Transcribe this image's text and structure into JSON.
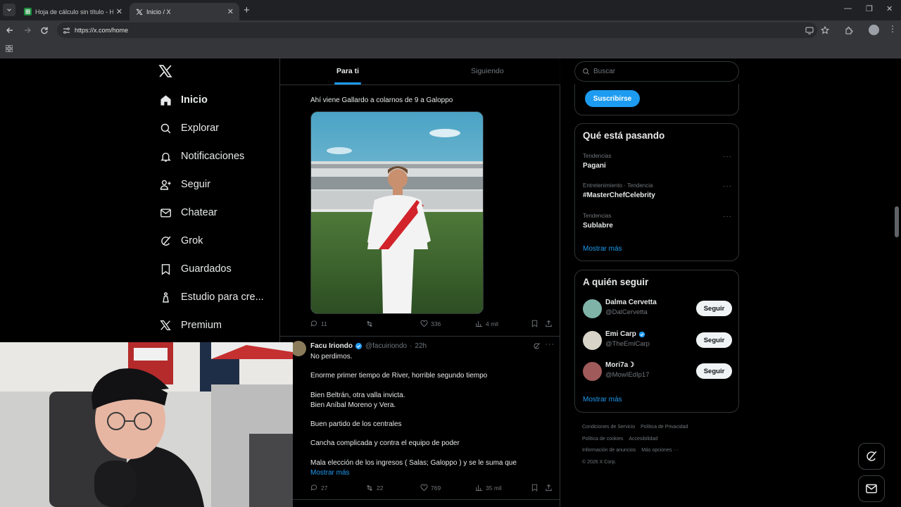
{
  "browser": {
    "tabs": [
      {
        "title": "Hoja de cálculo sin título - Hojas",
        "icon": "sheets-icon"
      },
      {
        "title": "Inicio / X",
        "icon": "x-logo-icon"
      }
    ],
    "url": "https://x.com/home"
  },
  "nav": {
    "items": [
      {
        "label": "Inicio",
        "icon": "home-icon"
      },
      {
        "label": "Explorar",
        "icon": "search-icon"
      },
      {
        "label": "Notificaciones",
        "icon": "bell-icon"
      },
      {
        "label": "Seguir",
        "icon": "follow-icon"
      },
      {
        "label": "Chatear",
        "icon": "mail-icon"
      },
      {
        "label": "Grok",
        "icon": "grok-icon"
      },
      {
        "label": "Guardados",
        "icon": "bookmark-icon"
      },
      {
        "label": "Estudio para cre...",
        "icon": "studio-icon"
      },
      {
        "label": "Premium",
        "icon": "x-logo-icon"
      }
    ]
  },
  "feed": {
    "tabs": [
      "Para ti",
      "Siguiendo"
    ],
    "tweet1": {
      "text": "Ahí viene Gallardo a colarnos de 9 a Galoppo",
      "replies": "11",
      "likes": "336",
      "views": "4 mil"
    },
    "tweet2": {
      "name": "Facu Iriondo",
      "handle": "@facuiriondo",
      "time": "22h",
      "lines": [
        "No perdimos.",
        "Enorme primer tiempo de River, horrible segundo tiempo",
        "Bien Beltrán, otra valla invicta.",
        "Bien Aníbal Moreno y Vera.",
        "Buen partido de los centrales",
        "Cancha complicada y contra el equipo de poder",
        "Mala elección de los ingresos ( Salas; Galoppo ) y se le suma que"
      ],
      "show_more": "Mostrar más",
      "replies": "27",
      "reposts": "22",
      "likes": "769",
      "views": "35 mil"
    }
  },
  "sidebar": {
    "search_placeholder": "Buscar",
    "subscribe_label": "Suscribirse",
    "trends_title": "Qué está pasando",
    "trends": [
      {
        "category": "Tendencias",
        "name": "Pagani"
      },
      {
        "category": "Entretenimiento · Tendencia",
        "name": "#MasterChefCelebrity"
      },
      {
        "category": "Tendencias",
        "name": "Sublabre"
      }
    ],
    "trends_more": "Mostrar más",
    "follow_title": "A quién seguir",
    "follow": [
      {
        "name": "Dalma Cervetta",
        "handle": "@DalCervetta",
        "verified": false,
        "button": "Seguir",
        "avatar_color": "#7fb3a8"
      },
      {
        "name": "Emi Carp",
        "handle": "@TheEmiCarp",
        "verified": true,
        "button": "Seguir",
        "avatar_color": "#d8d4c8"
      },
      {
        "name": "Mori7a☽",
        "handle": "@MowIEdIp17",
        "verified": false,
        "button": "Seguir",
        "avatar_color": "#a05a5a"
      }
    ],
    "follow_more": "Mostrar más",
    "footer": [
      "Condiciones de Servicio",
      "Política de Privacidad",
      "Política de cookies",
      "Accesibilidad",
      "Información de anuncios",
      "Más opciones ···",
      "© 2026 X Corp."
    ]
  },
  "colors": {
    "accent": "#1d9bf0",
    "bg": "#000000",
    "border": "#2f3336",
    "muted": "#71767b"
  }
}
